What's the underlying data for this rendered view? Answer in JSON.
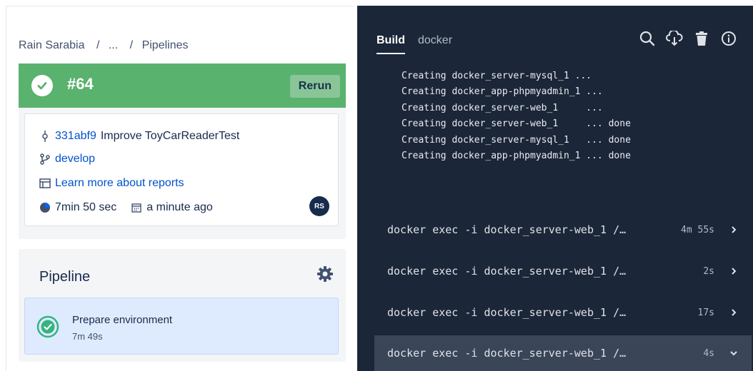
{
  "breadcrumb": {
    "owner": "Rain Sarabia",
    "sep1": "/",
    "ellipsis": "...",
    "sep2": "/",
    "current": "Pipelines"
  },
  "build": {
    "number": "#64",
    "rerun_label": "Rerun",
    "status_color": "#59b26e"
  },
  "details": {
    "commit_hash": "331abf9",
    "commit_message": "Improve ToyCarReaderTest",
    "branch": "develop",
    "reports_link": "Learn more about reports",
    "duration": "7min 50 sec",
    "time_ago": "a minute ago",
    "avatar_initials": "RS"
  },
  "pipeline": {
    "title": "Pipeline",
    "steps": [
      {
        "name": "Prepare environment",
        "duration": "7m 49s"
      }
    ]
  },
  "console": {
    "tabs": [
      "Build",
      "docker"
    ],
    "active_tab": "Build",
    "icons": [
      "search-icon",
      "download-cloud-icon",
      "trash-icon",
      "info-icon"
    ],
    "log_lines": [
      "Creating docker_server-mysql_1 ...",
      "Creating docker_app-phpmyadmin_1 ...",
      "Creating docker_server-web_1     ...",
      "Creating docker_server-web_1     ... done",
      "Creating docker_server-mysql_1   ... done",
      "Creating docker_app-phpmyadmin_1 ... done"
    ],
    "commands": [
      {
        "text": "docker exec -i docker_server-web_1 /…",
        "duration": "4m 55s",
        "expanded": false
      },
      {
        "text": "docker exec -i docker_server-web_1 /…",
        "duration": "2s",
        "expanded": false
      },
      {
        "text": "docker exec -i docker_server-web_1 /…",
        "duration": "17s",
        "expanded": false
      },
      {
        "text": "docker exec -i docker_server-web_1 /…",
        "duration": "4s",
        "expanded": true
      }
    ]
  }
}
